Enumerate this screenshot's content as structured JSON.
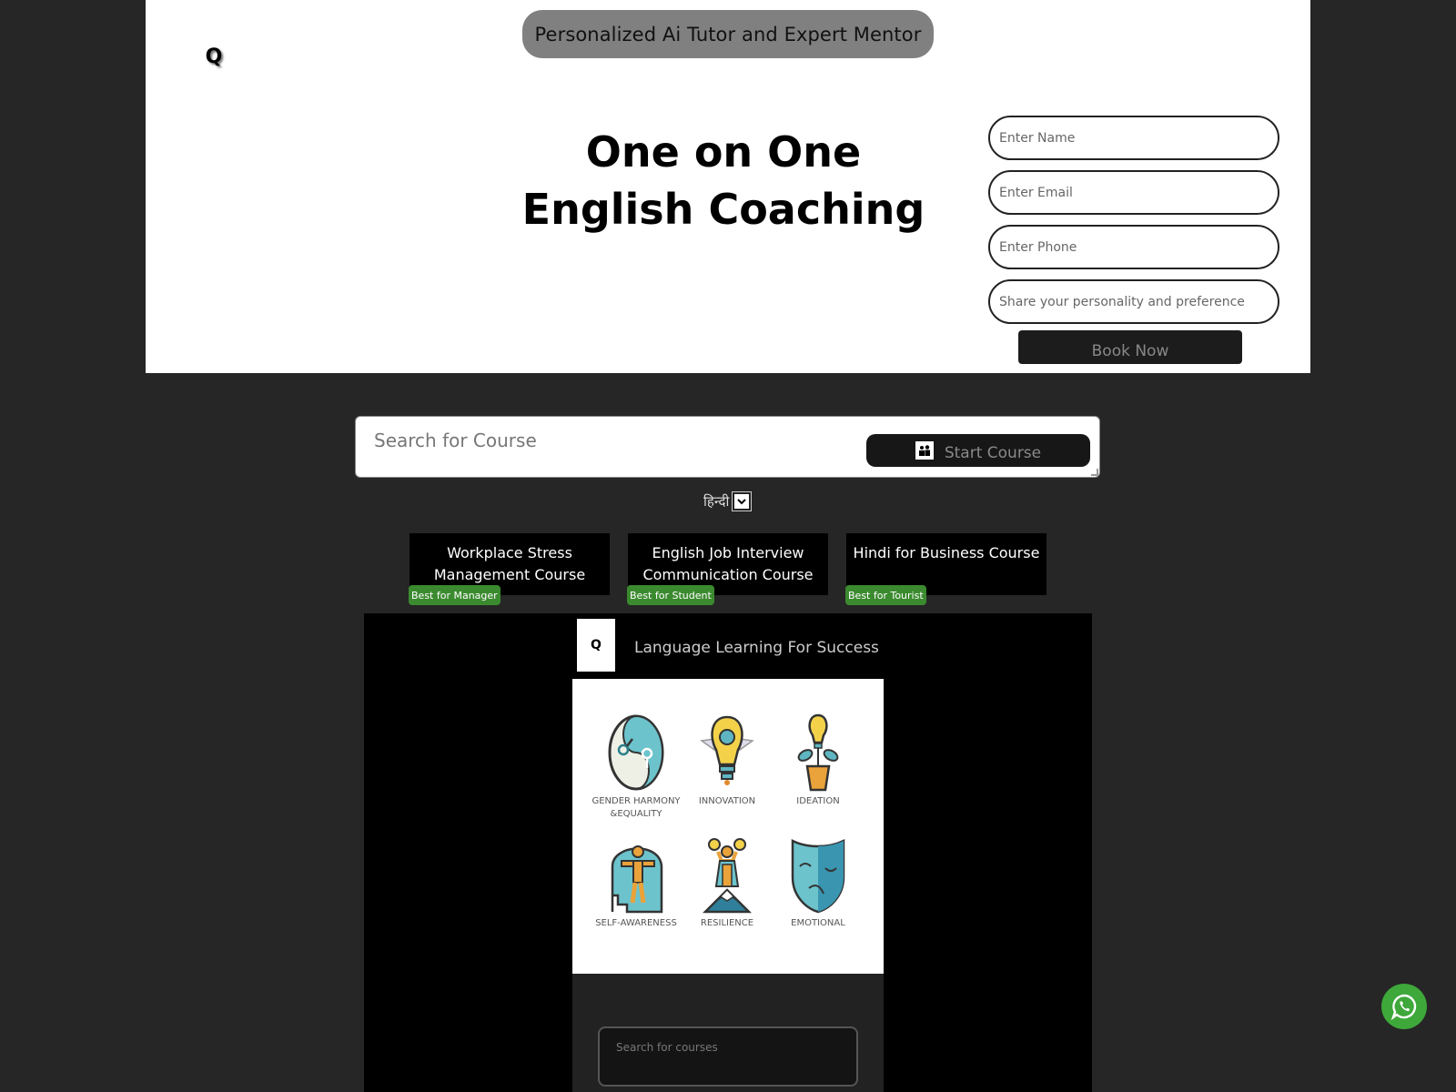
{
  "hero": {
    "tagline": "Personalized Ai Tutor and Expert Mentor",
    "logo_glyph": "Q",
    "title_line1": "One on One",
    "title_line2": "English Coaching",
    "form": {
      "name_placeholder": "Enter Name",
      "email_placeholder": "Enter Email",
      "phone_placeholder": "Enter Phone",
      "preference_placeholder": "Share your personality and preference",
      "submit_label": "Book Now"
    }
  },
  "search": {
    "placeholder": "Search for Course",
    "start_label": "Start Course",
    "start_icon": "people-icon"
  },
  "language": {
    "selected": "हिन्दी",
    "dropdown_glyph": "⌄"
  },
  "courses": [
    {
      "title": "Workplace Stress Management Course",
      "badge": "Best for Manager"
    },
    {
      "title": "English Job Interview Communication Course",
      "badge": "Best for Student"
    },
    {
      "title": "Hindi for Business Course",
      "badge": "Best for Tourist"
    }
  ],
  "promo": {
    "logo_glyph": "Q",
    "title": "Language Learning For Success",
    "skills": [
      {
        "label": "GENDER HARMONY &EQUALITY",
        "icon": "yin-yang-gender-icon"
      },
      {
        "label": "INNOVATION",
        "icon": "winged-bulb-icon"
      },
      {
        "label": "IDEATION",
        "icon": "bulb-plant-icon"
      },
      {
        "label": "SELF-AWARENESS",
        "icon": "head-person-icon"
      },
      {
        "label": "RESILIENCE",
        "icon": "summit-person-icon"
      },
      {
        "label": "EMOTIONAL",
        "icon": "mask-icon"
      }
    ],
    "search_placeholder": "Search for courses"
  },
  "colors": {
    "page_bg": "#262626",
    "badge_green": "#3b8a2f",
    "whatsapp_green": "#3ea83a",
    "tagline_bg": "#808080"
  }
}
